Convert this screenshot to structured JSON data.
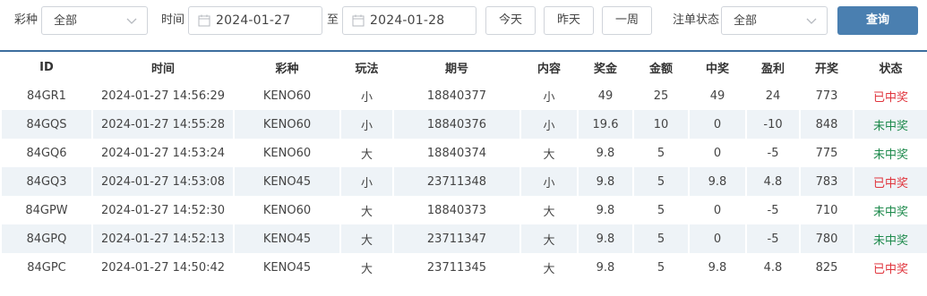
{
  "filters": {
    "lottery_label": "彩种",
    "lottery_value": "全部",
    "time_label": "时间",
    "date_from": "2024-01-27",
    "to_label": "至",
    "date_to": "2024-01-28",
    "today_label": "今天",
    "yesterday_label": "昨天",
    "week_label": "一周",
    "status_label": "注单状态",
    "status_value": "全部",
    "query_label": "查询"
  },
  "table": {
    "headers": [
      "ID",
      "时间",
      "彩种",
      "玩法",
      "期号",
      "内容",
      "奖金",
      "金额",
      "中奖",
      "盈利",
      "开奖",
      "状态"
    ],
    "rows": [
      [
        "84GR1",
        "2024-01-27 14:56:29",
        "KENO60",
        "小",
        "18840377",
        "小",
        "49",
        "25",
        "49",
        "24",
        "773",
        "已中奖"
      ],
      [
        "84GQS",
        "2024-01-27 14:55:28",
        "KENO60",
        "小",
        "18840376",
        "小",
        "19.6",
        "10",
        "0",
        "-10",
        "848",
        "未中奖"
      ],
      [
        "84GQ6",
        "2024-01-27 14:53:24",
        "KENO60",
        "大",
        "18840374",
        "大",
        "9.8",
        "5",
        "0",
        "-5",
        "775",
        "未中奖"
      ],
      [
        "84GQ3",
        "2024-01-27 14:53:08",
        "KENO45",
        "小",
        "23711348",
        "小",
        "9.8",
        "5",
        "9.8",
        "4.8",
        "783",
        "已中奖"
      ],
      [
        "84GPW",
        "2024-01-27 14:52:30",
        "KENO60",
        "大",
        "18840373",
        "大",
        "9.8",
        "5",
        "0",
        "-5",
        "710",
        "未中奖"
      ],
      [
        "84GPQ",
        "2024-01-27 14:52:13",
        "KENO45",
        "大",
        "23711347",
        "大",
        "9.8",
        "5",
        "0",
        "-5",
        "780",
        "未中奖"
      ],
      [
        "84GPC",
        "2024-01-27 14:50:42",
        "KENO45",
        "大",
        "23711345",
        "大",
        "9.8",
        "5",
        "9.8",
        "4.8",
        "825",
        "已中奖"
      ]
    ]
  },
  "colors": {
    "accent": "#4a7fb0",
    "divider": "#3c6e9e",
    "won": "#e0343c",
    "lost": "#1e8a4c",
    "alt_row": "#eef3f7"
  }
}
